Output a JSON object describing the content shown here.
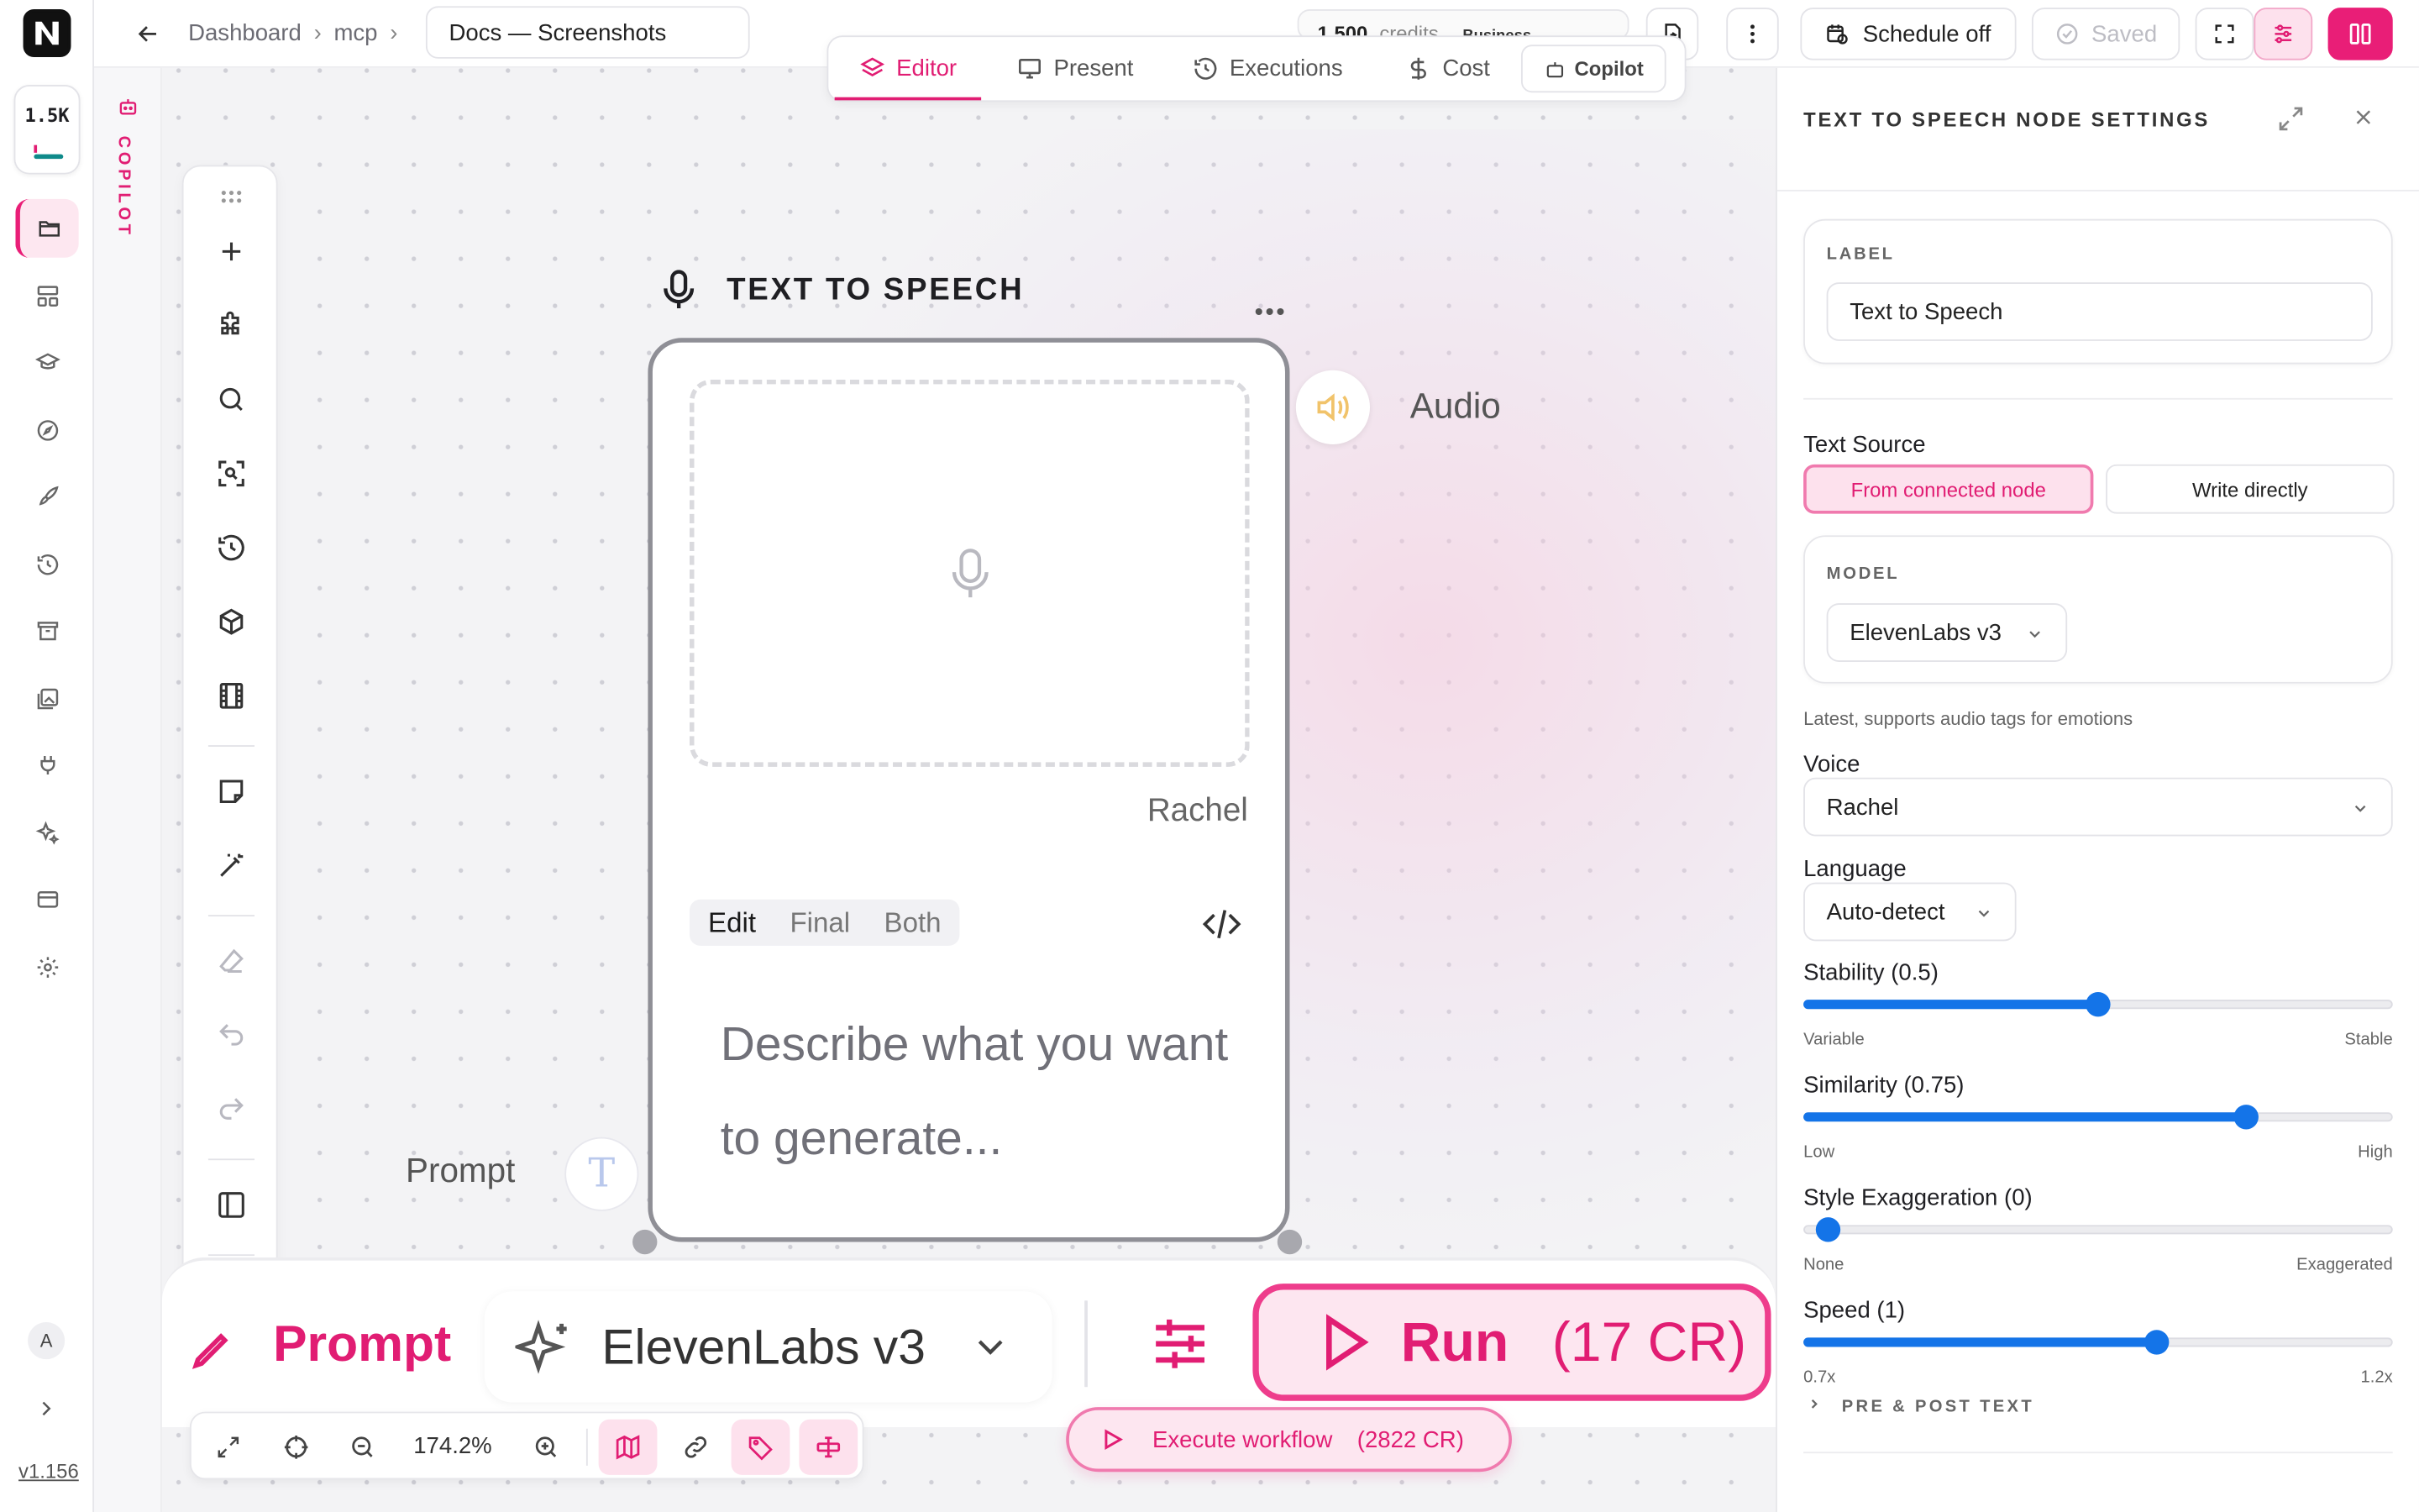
{
  "app": {
    "logo_letter": "N",
    "credits_short": "1.5K",
    "version": "v1.156",
    "user_initial": "A",
    "copilot_strip_label": "COPILOT"
  },
  "colors": {
    "accent": "#e11d73",
    "slider": "#1474e8",
    "teal": "#0e8a8a"
  },
  "sidebar": {
    "items": [
      {
        "icon": "folder-icon",
        "active": true
      },
      {
        "icon": "layout-icon"
      },
      {
        "icon": "graduation-cap-icon"
      },
      {
        "icon": "compass-icon"
      },
      {
        "icon": "rocket-icon"
      },
      {
        "icon": "history-icon"
      },
      {
        "icon": "archive-icon"
      },
      {
        "icon": "image-gallery-icon"
      },
      {
        "icon": "plug-icon"
      },
      {
        "icon": "sparkles-icon"
      },
      {
        "icon": "credit-card-icon"
      },
      {
        "icon": "gear-icon"
      }
    ]
  },
  "topbar": {
    "breadcrumb": [
      "Dashboard",
      "mcp"
    ],
    "doc_title": "Docs — Screenshots",
    "credits_value": "1,500",
    "credits_word": "credits",
    "tier": "Business",
    "schedule_label": "Schedule off",
    "saved_label": "Saved"
  },
  "mode_tabs": {
    "items": [
      "Editor",
      "Present",
      "Executions",
      "Cost"
    ],
    "active": "Editor",
    "copilot_label": "Copilot"
  },
  "node": {
    "title": "TEXT TO SPEECH",
    "voice": "Rachel",
    "view_modes": [
      "Edit",
      "Final",
      "Both"
    ],
    "active_view": "Edit",
    "prompt_placeholder": "Describe what you want to generate...",
    "output_label": "Audio",
    "input_label": "Prompt",
    "input_port_glyph": "T"
  },
  "promptbar": {
    "label": "Prompt",
    "model": "ElevenLabs v3",
    "run_label": "Run",
    "run_cost": "(17 CR)"
  },
  "zoombar": {
    "zoom": "174.2%"
  },
  "execute": {
    "label": "Execute workflow",
    "cost": "(2822 CR)"
  },
  "panel": {
    "title": "TEXT TO SPEECH NODE SETTINGS",
    "label_caption": "LABEL",
    "label_value": "Text to Speech",
    "text_source_label": "Text Source",
    "text_source_options": [
      "From connected node",
      "Write directly"
    ],
    "model_caption": "MODEL",
    "model_value": "ElevenLabs v3",
    "model_hint": "Latest, supports audio tags for emotions",
    "voice_label": "Voice",
    "voice_value": "Rachel",
    "language_label": "Language",
    "language_value": "Auto-detect",
    "sliders": [
      {
        "label": "Stability (0.5)",
        "fraction": 0.5,
        "min_label": "Variable",
        "max_label": "Stable"
      },
      {
        "label": "Similarity (0.75)",
        "fraction": 0.75,
        "min_label": "Low",
        "max_label": "High"
      },
      {
        "label": "Style Exaggeration (0)",
        "fraction": 0.0,
        "min_label": "None",
        "max_label": "Exaggerated"
      },
      {
        "label": "Speed (1)",
        "fraction": 0.6,
        "min_label": "0.7x",
        "max_label": "1.2x"
      }
    ],
    "prepost_label": "PRE & POST TEXT"
  }
}
